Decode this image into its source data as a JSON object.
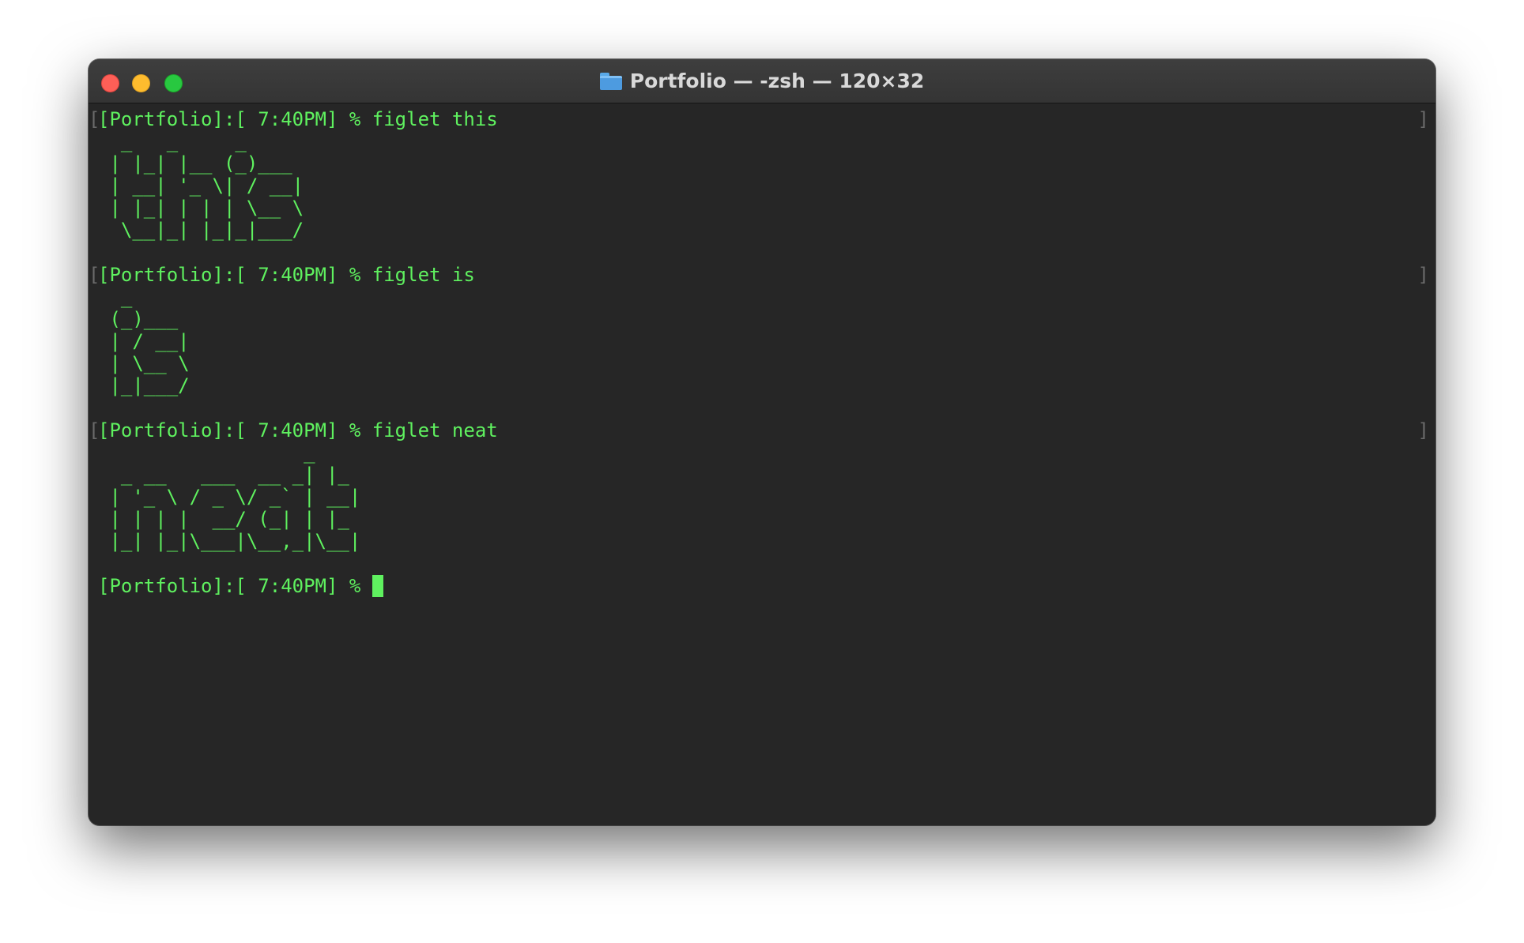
{
  "window": {
    "title": "Portfolio — -zsh — 120×32",
    "folder_icon": "folder-icon",
    "traffic_lights": {
      "close": "#fe5f57",
      "minimize": "#febc2e",
      "zoom": "#28c840"
    }
  },
  "terminal": {
    "text_color": "#5ff15f",
    "background": "#262626",
    "entries": [
      {
        "prompt": "[Portfolio]:[ 7:40PM] % figlet this",
        "left_mark": "[",
        "right_mark": "]",
        "output": "  _   _     _\n | |_| |__ (_)___\n | __| '_ \\| / __|\n | |_| | | | \\__ \\\n  \\__|_| |_|_|___/"
      },
      {
        "prompt": "[Portfolio]:[ 7:40PM] % figlet is",
        "left_mark": "[",
        "right_mark": "]",
        "output": "  _\n (_)___\n | / __|\n | \\__ \\\n |_|___/"
      },
      {
        "prompt": "[Portfolio]:[ 7:40PM] % figlet neat",
        "left_mark": "[",
        "right_mark": "]",
        "output": "                  _\n  _ __   ___  __ _| |_\n | '_ \\ / _ \\/ _` | __|\n | | | |  __/ (_| | |_\n |_| |_|\\___|\\__,_|\\__|"
      }
    ],
    "current_prompt": "[Portfolio]:[ 7:40PM] % "
  }
}
